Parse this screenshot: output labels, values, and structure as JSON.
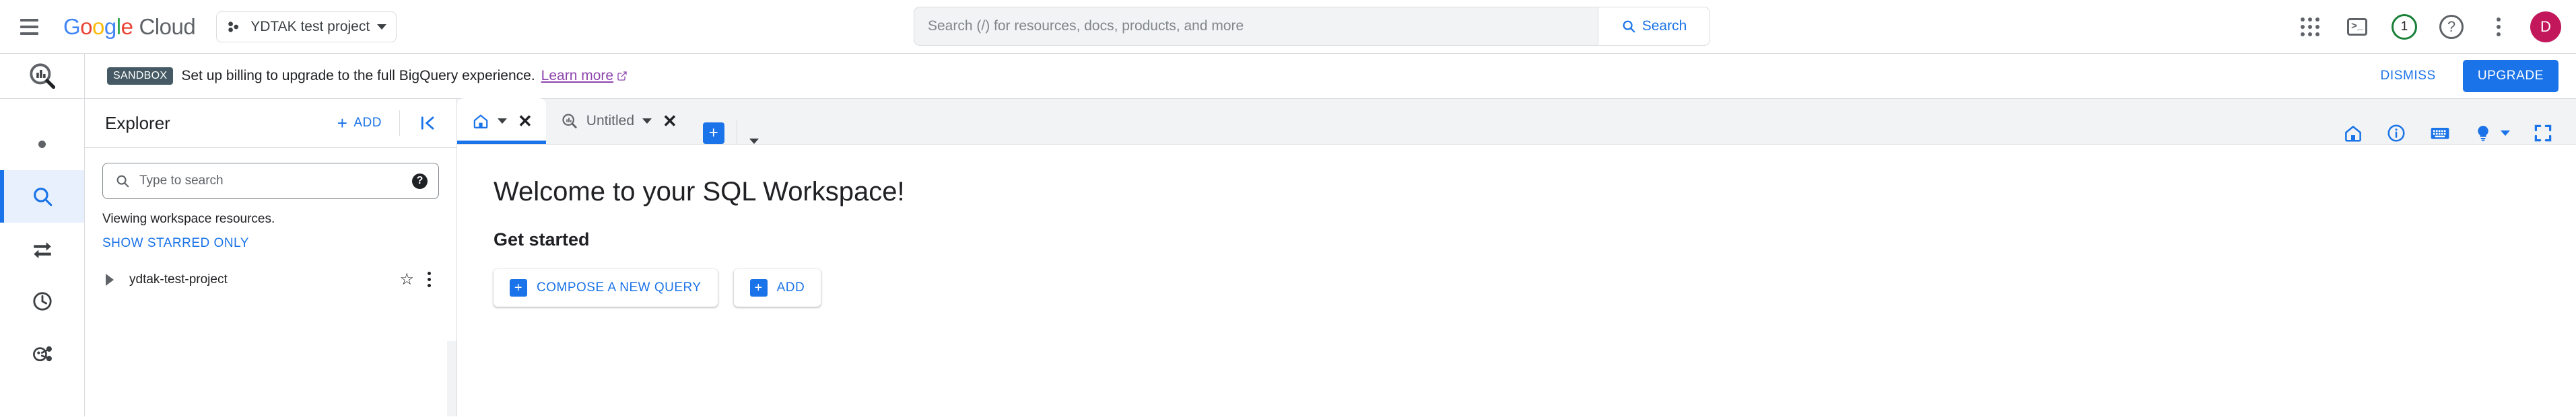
{
  "topbar": {
    "menu_icon": "hamburger-menu-icon",
    "logo": {
      "g1": "G",
      "o1": "o",
      "o2": "o",
      "g2": "g",
      "l": "l",
      "e": "e",
      "cloud": "Cloud"
    },
    "project_selector": {
      "label": "YDTAK test project",
      "icon": "project-cluster-icon"
    },
    "search": {
      "placeholder": "Search (/) for resources, docs, products, and more",
      "value": "",
      "button_label": "Search",
      "button_icon": "search-icon"
    },
    "actions": {
      "apps_icon": "apps-grid-icon",
      "terminal_icon": "cloud-shell-terminal-icon",
      "terminal_glyph": ">_",
      "notifications_count": "1",
      "notifications_icon": "notification-ring-icon",
      "help_icon": "help-question-icon",
      "help_glyph": "?",
      "more_icon": "more-vertical-icon",
      "avatar_initial": "D"
    }
  },
  "banner": {
    "badge": "SANDBOX",
    "message": "Set up billing to upgrade to the full BigQuery experience.",
    "link_label": "Learn more",
    "link_icon": "external-link-icon",
    "dismiss_label": "DISMISS",
    "upgrade_label": "UPGRADE",
    "product_icon": "bigquery-logo-icon"
  },
  "rail": {
    "items": [
      {
        "name": "rail-item-dot",
        "icon": "dot-icon",
        "active": false
      },
      {
        "name": "rail-item-search",
        "icon": "search-icon",
        "active": true
      },
      {
        "name": "rail-item-transfers",
        "icon": "transfer-arrows-icon",
        "active": false
      },
      {
        "name": "rail-item-history",
        "icon": "clock-history-icon",
        "active": false
      },
      {
        "name": "rail-item-scheduled",
        "icon": "scheduled-queries-icon",
        "active": false
      }
    ]
  },
  "explorer": {
    "title": "Explorer",
    "add_label": "ADD",
    "add_icon": "plus-icon",
    "collapse_icon": "collapse-panel-icon",
    "search": {
      "placeholder": "Type to search",
      "value": "",
      "icon": "search-icon",
      "help_icon": "help-icon",
      "help_glyph": "?"
    },
    "viewing_text": "Viewing workspace resources.",
    "show_starred_label": "SHOW STARRED ONLY",
    "project": {
      "name": "ydtak-test-project",
      "expand_icon": "expand-triangle-icon",
      "star_icon": "star-outline-icon",
      "star_glyph": "☆",
      "more_icon": "more-vertical-icon"
    }
  },
  "workspace": {
    "tabs": [
      {
        "label": "",
        "icon": "home-icon",
        "active": true,
        "has_caret": true,
        "has_close": true
      },
      {
        "label": "Untitled",
        "icon": "bigquery-query-icon",
        "active": false,
        "has_caret": true,
        "has_close": true
      }
    ],
    "new_tab_icon": "plus-icon",
    "new_tab_caret_icon": "chevron-down-icon",
    "toolbar": [
      {
        "name": "home-icon"
      },
      {
        "name": "info-icon"
      },
      {
        "name": "keyboard-shortcuts-icon"
      },
      {
        "name": "lightbulb-tips-icon"
      },
      {
        "name": "fullscreen-icon"
      }
    ],
    "content": {
      "heading": "Welcome to your SQL Workspace!",
      "subheading": "Get started",
      "buttons": [
        {
          "label": "COMPOSE A NEW QUERY",
          "icon": "plus-square-icon"
        },
        {
          "label": "ADD",
          "icon": "plus-square-icon"
        }
      ]
    }
  },
  "colors": {
    "accent_blue": "#1a73e8",
    "badge_slate": "#455a64",
    "link_purple": "#8e44ad",
    "notif_green": "#188038",
    "avatar_pink": "#c2185b",
    "strip_gray": "#f1f3f4"
  }
}
